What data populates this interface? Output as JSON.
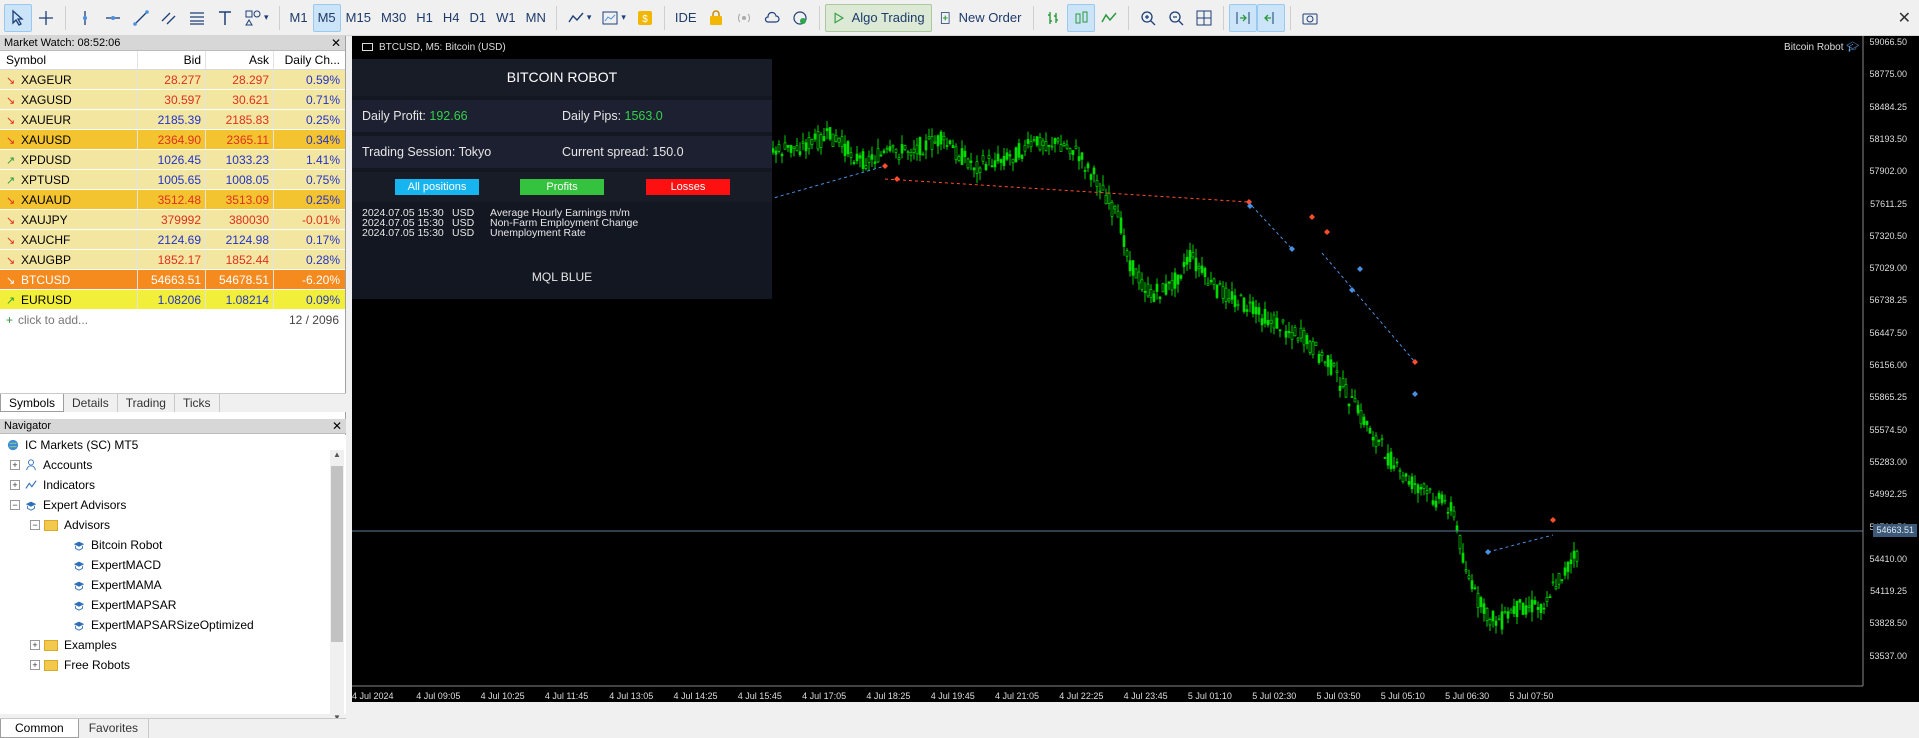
{
  "toolbar": {
    "timeframes": [
      "M1",
      "M5",
      "M15",
      "M30",
      "H1",
      "H4",
      "D1",
      "W1",
      "MN"
    ],
    "active_timeframe": "M5",
    "ide_label": "IDE",
    "algo_trading_label": "Algo Trading",
    "new_order_label": "New Order"
  },
  "market_watch": {
    "title": "Market Watch: 08:52:06",
    "columns": [
      "Symbol",
      "Bid",
      "Ask",
      "Daily Ch..."
    ],
    "rows": [
      {
        "symbol": "XAGEUR",
        "bid": "28.277",
        "ask": "28.297",
        "change": "0.59%",
        "dir": "down",
        "bg": "#f2e6a1",
        "bidColor": "#e03020",
        "askColor": "#e03020"
      },
      {
        "symbol": "XAGUSD",
        "bid": "30.597",
        "ask": "30.621",
        "change": "0.71%",
        "dir": "down",
        "bg": "#f2e6a1",
        "bidColor": "#e03020",
        "askColor": "#e03020"
      },
      {
        "symbol": "XAUEUR",
        "bid": "2185.39",
        "ask": "2185.83",
        "change": "0.25%",
        "dir": "down",
        "bg": "#f2e6a1",
        "bidColor": "#2233cc",
        "askColor": "#e03020"
      },
      {
        "symbol": "XAUUSD",
        "bid": "2364.90",
        "ask": "2365.11",
        "change": "0.34%",
        "dir": "down",
        "bg": "#f4c430",
        "bidColor": "#e03020",
        "askColor": "#e03020"
      },
      {
        "symbol": "XPDUSD",
        "bid": "1026.45",
        "ask": "1033.23",
        "change": "1.41%",
        "dir": "up",
        "bg": "#f2e6a1",
        "bidColor": "#2233cc",
        "askColor": "#2233cc"
      },
      {
        "symbol": "XPTUSD",
        "bid": "1005.65",
        "ask": "1008.05",
        "change": "0.75%",
        "dir": "up",
        "bg": "#f2e6a1",
        "bidColor": "#2233cc",
        "askColor": "#2233cc"
      },
      {
        "symbol": "XAUAUD",
        "bid": "3512.48",
        "ask": "3513.09",
        "change": "0.25%",
        "dir": "down",
        "bg": "#f4c430",
        "bidColor": "#e03020",
        "askColor": "#e03020"
      },
      {
        "symbol": "XAUJPY",
        "bid": "379992",
        "ask": "380030",
        "change": "-0.01%",
        "dir": "down",
        "bg": "#f2e6a1",
        "bidColor": "#e03020",
        "askColor": "#e03020"
      },
      {
        "symbol": "XAUCHF",
        "bid": "2124.69",
        "ask": "2124.98",
        "change": "0.17%",
        "dir": "down",
        "bg": "#f2e6a1",
        "bidColor": "#2233cc",
        "askColor": "#2233cc"
      },
      {
        "symbol": "XAUGBP",
        "bid": "1852.17",
        "ask": "1852.44",
        "change": "0.28%",
        "dir": "down",
        "bg": "#f2e6a1",
        "bidColor": "#e03020",
        "askColor": "#e03020"
      },
      {
        "symbol": "BTCUSD",
        "bid": "54663.51",
        "ask": "54678.51",
        "change": "-6.20%",
        "dir": "down",
        "bg": "#f58a1f",
        "bidColor": "#e03020",
        "askColor": "#e03020",
        "textColor": "#ffffff"
      },
      {
        "symbol": "EURUSD",
        "bid": "1.08206",
        "ask": "1.08214",
        "change": "0.09%",
        "dir": "up",
        "bg": "#f2ef3a",
        "bidColor": "#2233cc",
        "askColor": "#2233cc"
      }
    ],
    "add_label": "click to add...",
    "count": "12 / 2096",
    "tabs": [
      "Symbols",
      "Details",
      "Trading",
      "Ticks"
    ]
  },
  "navigator": {
    "title": "Navigator",
    "root": "IC Markets (SC) MT5",
    "accounts": "Accounts",
    "indicators": "Indicators",
    "expert_advisors": "Expert Advisors",
    "advisors": "Advisors",
    "experts": [
      "Bitcoin Robot",
      "ExpertMACD",
      "ExpertMAMA",
      "ExpertMAPSAR",
      "ExpertMAPSARSizeOptimized"
    ],
    "examples": "Examples",
    "free_robots": "Free Robots",
    "tabs": [
      "Common",
      "Favorites"
    ]
  },
  "chart": {
    "symbol_label": "BTCUSD, M5:  Bitcoin (USD)",
    "robot_tag": "Bitcoin Robot",
    "current_price": "54663.51",
    "price_ticks": [
      "59066.50",
      "58775.00",
      "58484.25",
      "58193.50",
      "57902.00",
      "57611.25",
      "57320.50",
      "57029.00",
      "56738.25",
      "56447.50",
      "56156.00",
      "55865.25",
      "55574.50",
      "55283.00",
      "54992.25",
      "54701.50",
      "54410.00",
      "54119.25",
      "53828.50",
      "53537.00"
    ],
    "time_ticks": [
      "4 Jul 2024",
      "4 Jul 09:05",
      "4 Jul 10:25",
      "4 Jul 11:45",
      "4 Jul 13:05",
      "4 Jul 14:25",
      "4 Jul 15:45",
      "4 Jul 17:05",
      "4 Jul 18:25",
      "4 Jul 19:45",
      "4 Jul 21:05",
      "4 Jul 22:25",
      "4 Jul 23:45",
      "5 Jul 01:10",
      "5 Jul 02:30",
      "5 Jul 03:50",
      "5 Jul 05:10",
      "5 Jul 06:30",
      "5 Jul 07:50"
    ],
    "colors": {
      "bull": "#00e000",
      "bear": "#00e000",
      "background": "#000000",
      "trade_line_loss": "#ff4d2e",
      "trade_line_win": "#4a90e2"
    }
  },
  "robot_panel": {
    "title": "BITCOIN ROBOT",
    "daily_profit_label": "Daily Profit:",
    "daily_profit_value": "192.66",
    "daily_pips_label": "Daily Pips:",
    "daily_pips_value": "1563.0",
    "session_label": "Trading Session: Tokyo",
    "spread_label": "Current spread: 150.0",
    "buttons": {
      "all": "All positions",
      "profits": "Profits",
      "losses": "Losses"
    },
    "news": [
      {
        "date": "2024.07.05 15:30",
        "currency": "USD",
        "event": "Average Hourly Earnings m/m"
      },
      {
        "date": "2024.07.05 15:30",
        "currency": "USD",
        "event": "Non-Farm Employment Change"
      },
      {
        "date": "2024.07.05 15:30",
        "currency": "USD",
        "event": "Unemployment Rate"
      }
    ],
    "footer": "MQL BLUE"
  }
}
